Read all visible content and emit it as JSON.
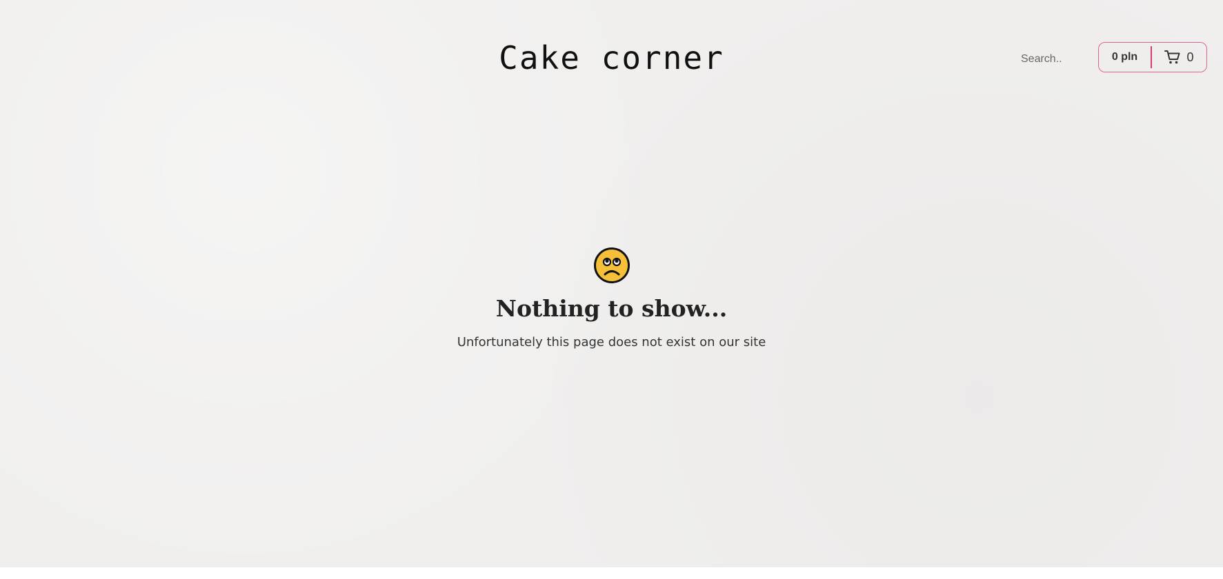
{
  "header": {
    "site_title": "Cake corner",
    "search_placeholder": "Search..",
    "cart_total": "0 pln",
    "cart_count": "0"
  },
  "empty_state": {
    "icon": "sad-face-icon",
    "heading": "Nothing to show...",
    "message": "Unfortunately this page does not exist on our site"
  },
  "colors": {
    "page_background": "#f0efee",
    "accent": "#e0638f",
    "divider": "#d83a6f",
    "emoji_face": "#f6bf3a"
  }
}
